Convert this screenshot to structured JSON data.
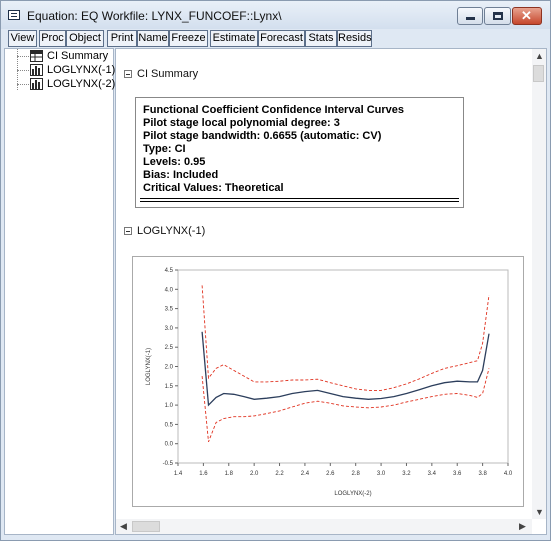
{
  "window": {
    "title": "Equation: EQ   Workfile: LYNX_FUNCOEF::Lynx\\",
    "controls": {
      "minimize": "minimize",
      "maximize": "maximize",
      "close": "✕"
    }
  },
  "toolbar": [
    "View",
    "Proc",
    "Object",
    "Print",
    "Name",
    "Freeze",
    "Estimate",
    "Forecast",
    "Stats",
    "Resids"
  ],
  "tree": [
    {
      "label": "CI Summary",
      "icon": "table-icon"
    },
    {
      "label": "LOGLYNX(-1)",
      "icon": "graph-icon"
    },
    {
      "label": "LOGLYNX(-2)",
      "icon": "graph-icon"
    }
  ],
  "sections": {
    "ci_summary": "CI Summary",
    "loglynx1": "LOGLYNX(-1)"
  },
  "summary": [
    "Functional Coefficient Confidence Interval Curves",
    "Pilot stage local polynomial degree: 3",
    "Pilot stage bandwidth: 0.6655 (automatic: CV)",
    "Type: CI",
    "Levels: 0.95",
    "Bias: Included",
    "Critical Values: Theoretical"
  ],
  "colors": {
    "estimate": "#2c3e5c",
    "bands": "#e0301e"
  },
  "chart_data": {
    "type": "line",
    "xlabel": "LOGLYNX(-2)",
    "ylabel": "LOGLYNX(-1)",
    "xlim": [
      1.4,
      4.0
    ],
    "ylim": [
      -0.5,
      4.5
    ],
    "xticks": [
      "1.4",
      "1.6",
      "1.8",
      "2.0",
      "2.2",
      "2.4",
      "2.6",
      "2.8",
      "3.0",
      "3.2",
      "3.4",
      "3.6",
      "3.8",
      "4.0"
    ],
    "yticks": [
      "-0.5",
      "0.0",
      "0.5",
      "1.0",
      "1.5",
      "2.0",
      "2.5",
      "3.0",
      "3.5",
      "4.0",
      "4.5"
    ],
    "x": [
      1.59,
      1.64,
      1.7,
      1.76,
      1.84,
      1.92,
      2.0,
      2.1,
      2.2,
      2.3,
      2.4,
      2.5,
      2.6,
      2.7,
      2.8,
      2.9,
      3.0,
      3.1,
      3.2,
      3.3,
      3.4,
      3.5,
      3.6,
      3.7,
      3.76,
      3.8,
      3.85
    ],
    "series": [
      {
        "role": "estimate",
        "style": "solid",
        "values": [
          2.9,
          1.0,
          1.2,
          1.3,
          1.28,
          1.22,
          1.15,
          1.18,
          1.22,
          1.3,
          1.35,
          1.38,
          1.3,
          1.22,
          1.18,
          1.15,
          1.17,
          1.22,
          1.3,
          1.4,
          1.5,
          1.58,
          1.62,
          1.6,
          1.6,
          1.9,
          2.85
        ]
      },
      {
        "role": "upper",
        "style": "dashed",
        "values": [
          4.1,
          1.7,
          1.95,
          2.05,
          1.9,
          1.75,
          1.6,
          1.6,
          1.62,
          1.65,
          1.65,
          1.67,
          1.58,
          1.5,
          1.42,
          1.38,
          1.38,
          1.45,
          1.55,
          1.68,
          1.82,
          1.95,
          2.02,
          2.1,
          2.15,
          2.6,
          3.85
        ]
      },
      {
        "role": "lower",
        "style": "dashed",
        "values": [
          1.75,
          0.05,
          0.55,
          0.65,
          0.7,
          0.7,
          0.72,
          0.78,
          0.85,
          0.95,
          1.05,
          1.1,
          1.05,
          0.98,
          0.95,
          0.93,
          0.95,
          1.0,
          1.08,
          1.15,
          1.22,
          1.28,
          1.3,
          1.25,
          1.2,
          1.3,
          1.95
        ]
      }
    ]
  }
}
